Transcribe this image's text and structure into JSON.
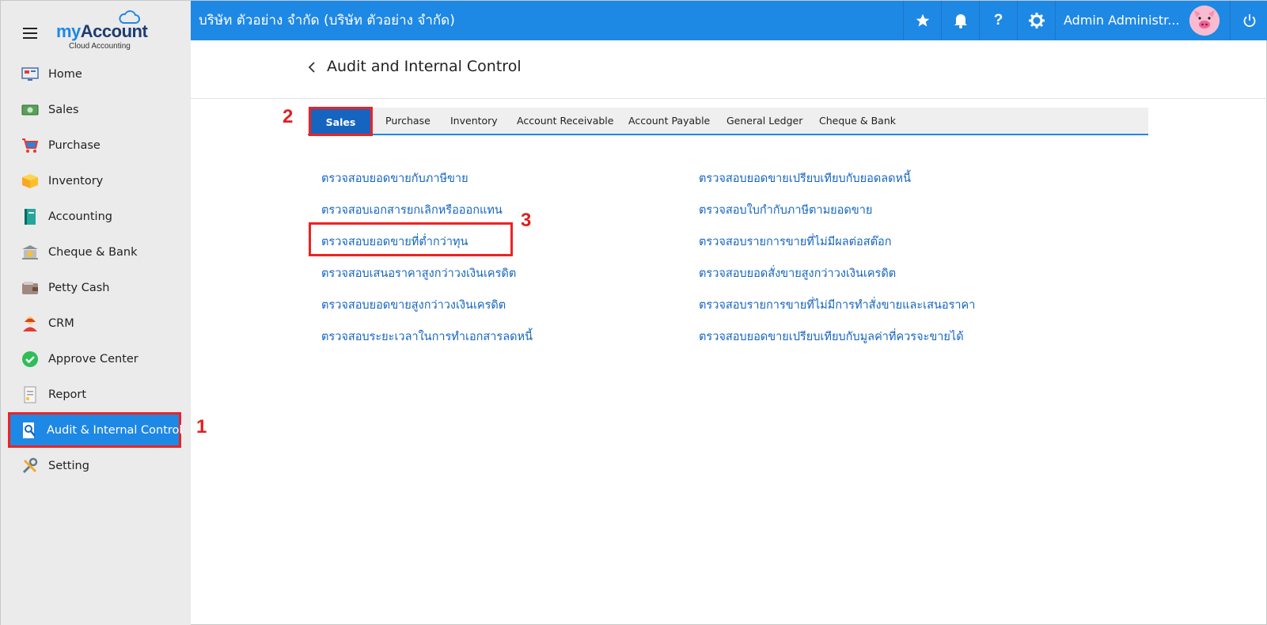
{
  "logo": {
    "brand_my": "my",
    "brand_account": "Account",
    "tagline": "Cloud Accounting"
  },
  "sidebar": {
    "items": [
      {
        "label": "Home",
        "icon": "home-monitor-icon"
      },
      {
        "label": "Sales",
        "icon": "sales-cash-icon"
      },
      {
        "label": "Purchase",
        "icon": "shopping-cart-icon"
      },
      {
        "label": "Inventory",
        "icon": "box-icon"
      },
      {
        "label": "Accounting",
        "icon": "ledger-book-icon"
      },
      {
        "label": "Cheque & Bank",
        "icon": "bank-icon"
      },
      {
        "label": "Petty Cash",
        "icon": "wallet-icon"
      },
      {
        "label": "CRM",
        "icon": "customer-icon"
      },
      {
        "label": "Approve Center",
        "icon": "check-circle-icon"
      },
      {
        "label": "Report",
        "icon": "report-icon"
      },
      {
        "label": "Audit & Internal Control",
        "icon": "audit-search-icon"
      },
      {
        "label": "Setting",
        "icon": "tools-icon"
      }
    ],
    "active_index": 10
  },
  "topbar": {
    "company": "บริษัท ตัวอย่าง จำกัด (บริษัท ตัวอย่าง จำกัด)",
    "user_name": "Admin Administr...",
    "bg_color": "#1e88e5"
  },
  "page": {
    "title": "Audit and Internal Control"
  },
  "tabs": [
    "Sales",
    "Purchase",
    "Inventory",
    "Account Receivable",
    "Account Payable",
    "General Ledger",
    "Cheque & Bank"
  ],
  "annotations": [
    "1",
    "2",
    "3"
  ],
  "links": {
    "left": [
      "ตรวจสอบยอดขายกับภาษีขาย",
      "ตรวจสอบเอกสารยกเลิกหรือออกแทน",
      "ตรวจสอบยอดขายที่ต่ำกว่าทุน",
      "ตรวจสอบเสนอราคาสูงกว่าวงเงินเครดิต",
      "ตรวจสอบยอดขายสูงกว่าวงเงินเครดิต",
      "ตรวจสอบระยะเวลาในการทำเอกสารลดหนี้"
    ],
    "right": [
      "ตรวจสอบยอดขายเปรียบเทียบกับยอดลดหนี้",
      "ตรวจสอบใบกำกับภาษีตามยอดขาย",
      "ตรวจสอบรายการขายที่ไม่มีผลต่อสต๊อก",
      "ตรวจสอบยอดสั่งขายสูงกว่าวงเงินเครดิต",
      "ตรวจสอบรายการขายที่ไม่มีการทำสั่งขายและเสนอราคา",
      "ตรวจสอบยอดขายเปรียบเทียบกับมูลค่าที่ควรจะขายได้"
    ]
  }
}
